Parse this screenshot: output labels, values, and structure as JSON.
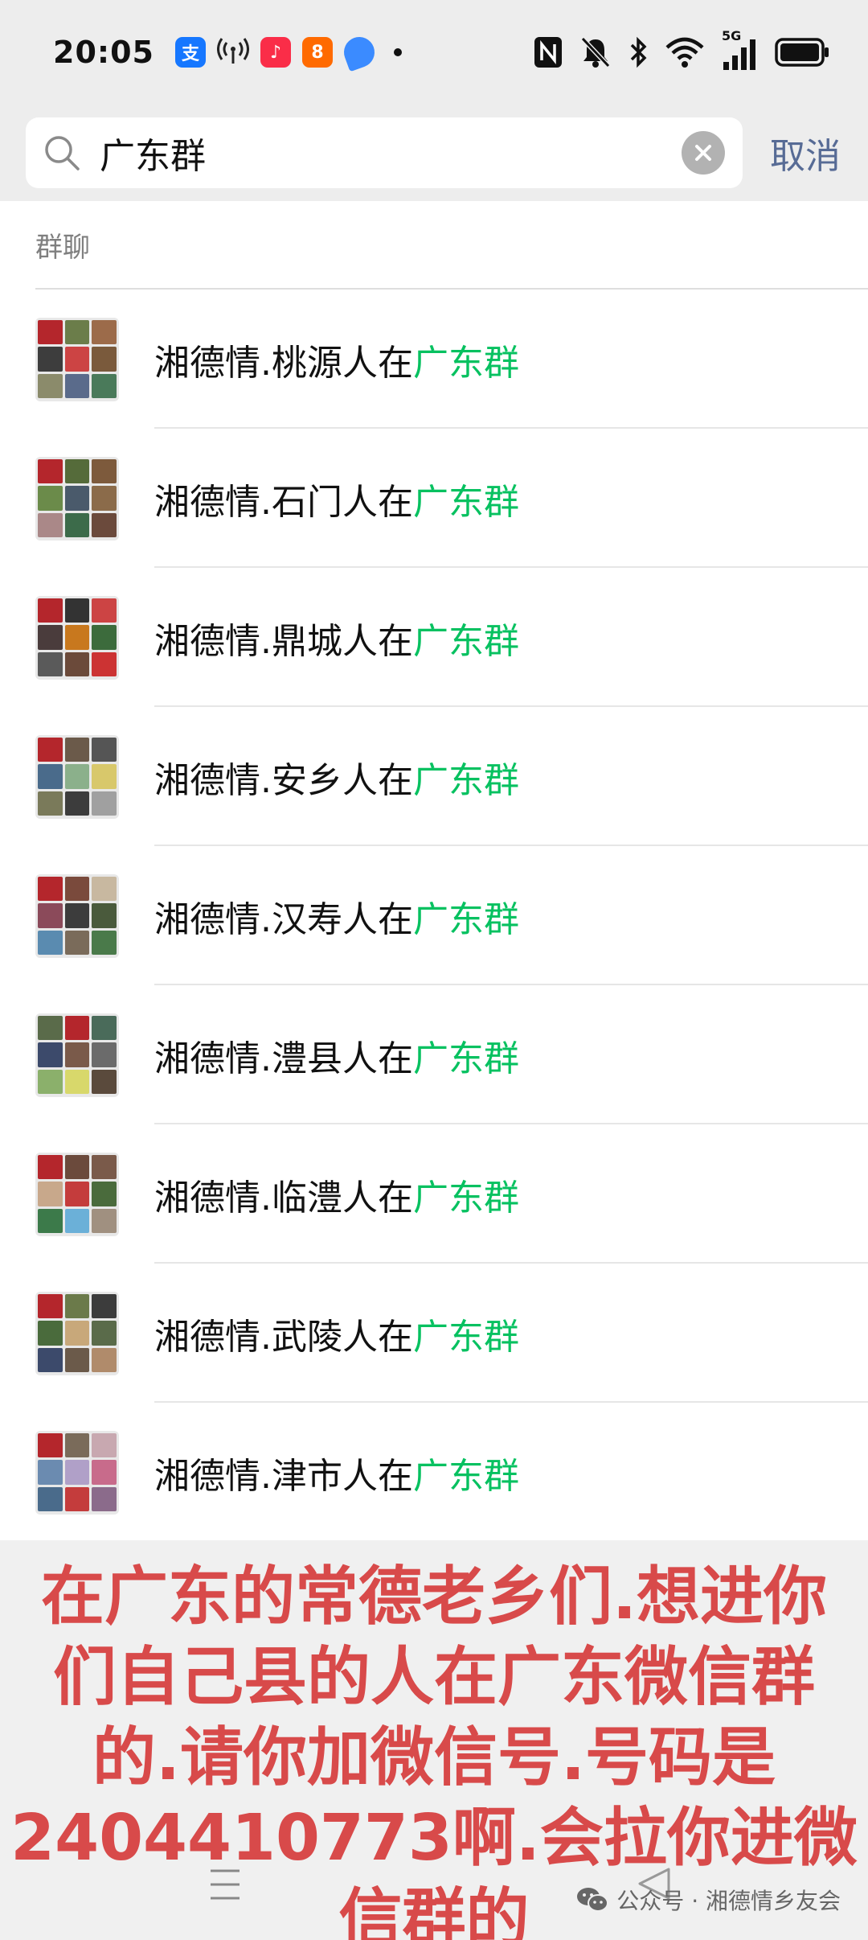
{
  "status_bar": {
    "time": "20:05",
    "app_icons": [
      {
        "name": "alipay-icon",
        "glyph": "支",
        "color": "#1677ff"
      },
      {
        "name": "hotspot-icon",
        "glyph": "((·))",
        "color": ""
      },
      {
        "name": "music-app-icon",
        "glyph": "♪",
        "color": "#fa2d48"
      },
      {
        "name": "video-app-icon",
        "glyph": "8",
        "color": "#ff6a00"
      },
      {
        "name": "feather-app-icon",
        "glyph": "⬮",
        "color": "#3b8bff"
      }
    ],
    "network_label": "5G"
  },
  "search": {
    "query": "广东群",
    "cancel_label": "取消"
  },
  "results": {
    "section_title": "群聊",
    "items": [
      {
        "prefix": "湘德情.桃源人在",
        "highlight": "广东群"
      },
      {
        "prefix": "湘德情.石门人在",
        "highlight": "广东群"
      },
      {
        "prefix": "湘德情.鼎城人在",
        "highlight": "广东群"
      },
      {
        "prefix": "湘德情.安乡人在",
        "highlight": "广东群"
      },
      {
        "prefix": "湘德情.汉寿人在",
        "highlight": "广东群"
      },
      {
        "prefix": "湘德情.澧县人在",
        "highlight": "广东群"
      },
      {
        "prefix": "湘德情.临澧人在",
        "highlight": "广东群"
      },
      {
        "prefix": "湘德情.武陵人在",
        "highlight": "广东群"
      },
      {
        "prefix": "湘德情.津市人在",
        "highlight": "广东群"
      }
    ]
  },
  "overlay": {
    "lines": [
      "在广东的常德老乡们.想进你",
      "们自己县的人在广东微信群",
      "的.请你加微信号.号码是",
      "2404410773啊.会拉你进微",
      "信群的"
    ]
  },
  "watermark": {
    "text": "公众号 · 湘德情乡友会"
  },
  "colors": {
    "highlight": "#07c160",
    "link": "#576b95",
    "overlay_text": "#d84a4a"
  }
}
